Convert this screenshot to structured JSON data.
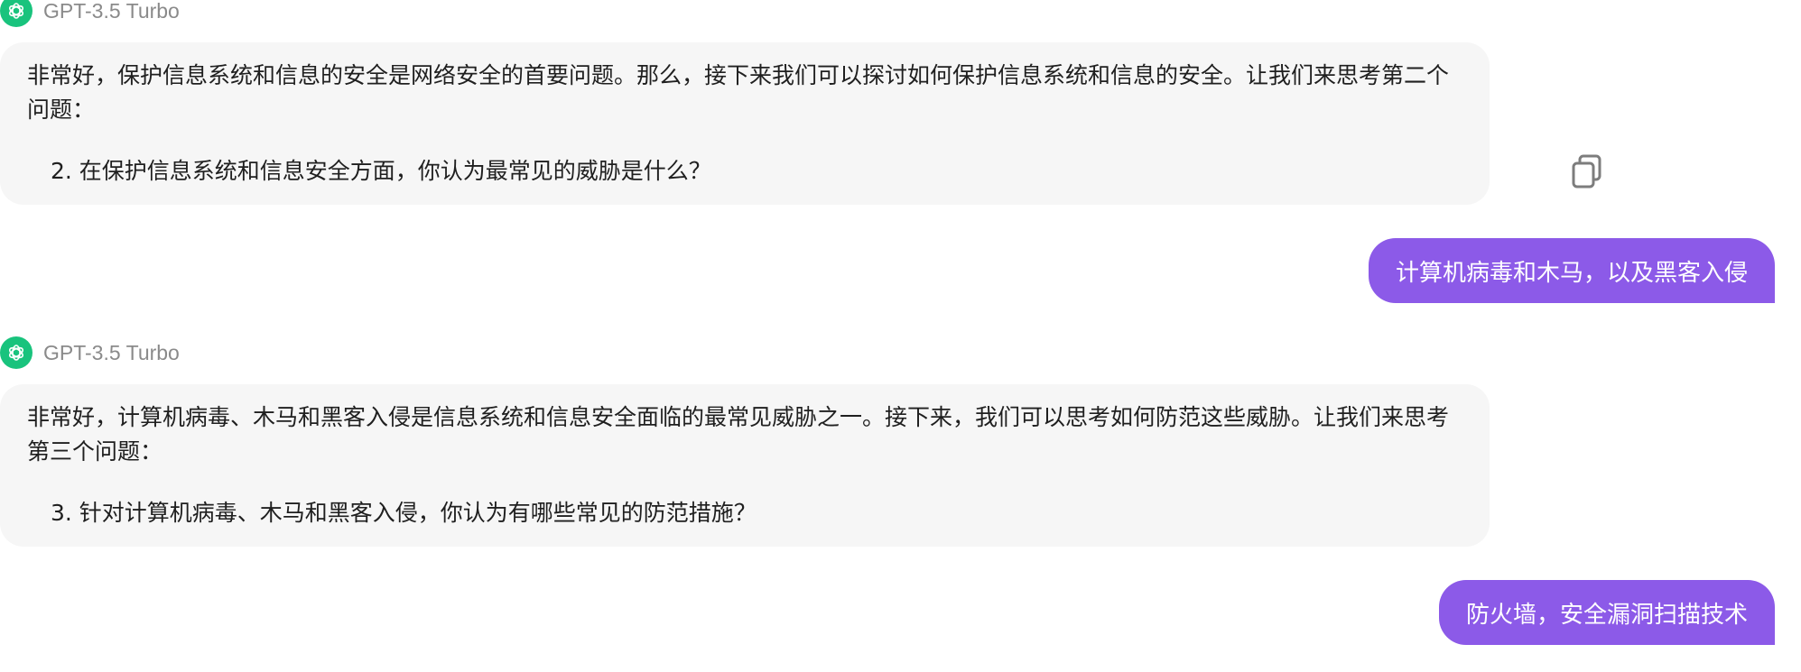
{
  "conversation": {
    "model_name_1": "GPT-3.5 Turbo",
    "assistant_1": {
      "text": "非常好，保护信息系统和信息的安全是网络安全的首要问题。那么，接下来我们可以探讨如何保护信息系统和信息的安全。让我们来思考第二个问题：",
      "question": "2. 在保护信息系统和信息安全方面，你认为最常见的威胁是什么？"
    },
    "user_1": "计算机病毒和木马，以及黑客入侵",
    "model_name_2": "GPT-3.5 Turbo",
    "assistant_2": {
      "text": "非常好，计算机病毒、木马和黑客入侵是信息系统和信息安全面临的最常见威胁之一。接下来，我们可以思考如何防范这些威胁。让我们来思考第三个问题：",
      "question": "3. 针对计算机病毒、木马和黑客入侵，你认为有哪些常见的防范措施？"
    },
    "user_2": "防火墙，安全漏洞扫描技术"
  },
  "icons": {
    "avatar": "openai-logo-icon",
    "copy": "copy-icon"
  },
  "colors": {
    "avatar_bg": "#19c37d",
    "user_bubble": "#8c5ae8",
    "assistant_bubble": "#f6f6f6",
    "model_name": "#8a8a8a"
  }
}
